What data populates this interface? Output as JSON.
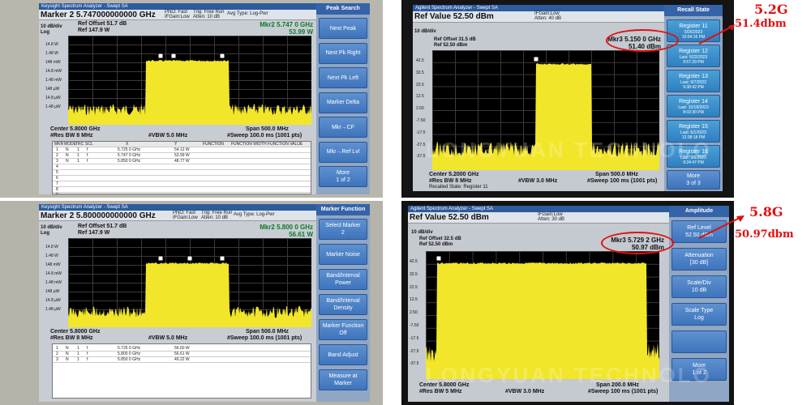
{
  "watermark": "LONGYUAN TECHNOLO",
  "p1": {
    "titlebar": "Keysight Spectrum Analyzer - Swept SA",
    "marker_label": "Marker 2  5.747000000000 GHz",
    "pno": "PNO: Fast",
    "ifgain": "IFGain:Low",
    "trig": "Trig: Free Run",
    "atten": "Atten: 10 dB",
    "avg": "Avg Type: Log-Pwr",
    "scale": "10 dB/div",
    "log": "Log",
    "ref_offset": "Ref Offset 51.7 dB",
    "ref": "Ref 147.9 W",
    "mkr_freq": "Mkr2  5.747 0 GHz",
    "mkr_val": "53.99 W",
    "yticks": [
      "14.8 W",
      "1.48 W",
      "148 mW",
      "14.8 mW",
      "1.48 mW",
      "148 µW",
      "14.8 µW",
      "1.48 µW"
    ],
    "center": "Center 5.8000 GHz",
    "res_bw": "#Res BW 8 MHz",
    "vbw": "#VBW 5.0 MHz",
    "span": "Span 500.0 MHz",
    "sweep": "#Sweep  100.0 ms (1001 pts)",
    "table_header": [
      "MKR",
      "MODE",
      "TRC",
      "SCL",
      "X",
      "Y",
      "FUNCTION",
      "FUNCTION WIDTH",
      "FUNCTION VALUE"
    ],
    "table_rows": [
      {
        "n": "1",
        "mode": "N",
        "trc": "1",
        "scl": "f",
        "x": "5.725 0 GHz",
        "y": "54.12 W"
      },
      {
        "n": "2",
        "mode": "N",
        "trc": "1",
        "scl": "f",
        "x": "5.747 0 GHz",
        "y": "53.99 W"
      },
      {
        "n": "3",
        "mode": "N",
        "trc": "1",
        "scl": "f",
        "x": "5.850 0 GHz",
        "y": "48.77 W"
      }
    ],
    "row_numbers": [
      "4",
      "5",
      "6",
      "7",
      "8",
      "9",
      "10",
      "11"
    ],
    "keys_title": "Peak Search",
    "keys": [
      "Next Peak",
      "Next Pk Right",
      "Next Pk Left",
      "Marker Delta",
      "Mkr→CF",
      "Mkr→Ref Lvl",
      "More\n1 of 2"
    ]
  },
  "p2": {
    "titlebar": "Keysight Spectrum Analyzer - Swept SA",
    "marker_label": "Marker 2  5.800000000000 GHz",
    "pno": "PNO: Fast",
    "ifgain": "IFGain:Low",
    "trig": "Trig: Free Run",
    "atten": "Atten: 10 dB",
    "avg": "Avg Type: Log-Pwr",
    "scale": "10 dB/div",
    "log": "Log",
    "ref_offset": "Ref Offset 51.7 dB",
    "ref": "Ref 147.9 W",
    "mkr_freq": "Mkr2  5.800 0 GHz",
    "mkr_val": "56.61 W",
    "yticks": [
      "14.8 W",
      "1.48 W",
      "148 mW",
      "14.8 mW",
      "1.48 mW",
      "148 µW",
      "14.8 µW",
      "1.48 µW"
    ],
    "center": "Center 5.8000 GHz",
    "res_bw": "#Res BW 8 MHz",
    "vbw": "#VBW 5.0 MHz",
    "span": "Span 500.0 MHz",
    "sweep": "#Sweep  100.0 ms (1001 pts)",
    "table_rows": [
      {
        "n": "1",
        "mode": "N",
        "trc": "1",
        "scl": "f",
        "x": "5.725 0 GHz",
        "y": "56.60 W"
      },
      {
        "n": "2",
        "mode": "N",
        "trc": "1",
        "scl": "f",
        "x": "5.800 0 GHz",
        "y": "56.61 W"
      },
      {
        "n": "3",
        "mode": "N",
        "trc": "1",
        "scl": "f",
        "x": "5.850 0 GHz",
        "y": "49.22 W"
      }
    ],
    "keys_title": "Marker Function",
    "keys": [
      "Select Marker\n2",
      "Marker Noise",
      "Band/Interval Power",
      "Band/Interval Density",
      "Marker Function Off",
      "Band Adjust",
      "Measure at Marker"
    ]
  },
  "p3": {
    "titlebar": "Agilent Spectrum Analyzer - Swept SA",
    "ref_value": "Ref Value 52.50 dBm",
    "ifgain": "IFGain:Low",
    "atten": "Atten: 40 dB",
    "scale": "10 dB/div",
    "ref_offset": "Ref Offset 31.5 dB",
    "ref": "Ref 52.50 dBm",
    "mkr_freq": "Mkr3  5.150 0 GHz",
    "mkr_val": "51.40 dBm",
    "yticks": [
      "42.5",
      "32.5",
      "22.5",
      "12.5",
      "2.50",
      "-7.50",
      "-17.5",
      "-27.5",
      "-37.5"
    ],
    "center": "Center 5.2000 GHz",
    "res_bw": "#Res BW 8 MHz",
    "vbw": "#VBW 3.0 MHz",
    "span": "Span 500.0 MHz",
    "sweep": "#Sweep  100 ms (1001 pts)",
    "status": "Recalled State: Register 11",
    "keys_title": "Recall State",
    "registers": [
      {
        "name": "Register 11",
        "date": "5/26/2023",
        "time": "10:04:16 PM"
      },
      {
        "name": "Register 12",
        "date": "Last: 5/22/2023",
        "time": "9:57:29 PM"
      },
      {
        "name": "Register 13",
        "date": "Last: 9/7/2023",
        "time": "9:38:42 PM"
      },
      {
        "name": "Register 14",
        "date": "Last: 10/18/2023",
        "time": "8:03:30 PM"
      },
      {
        "name": "Register 15",
        "date": "Last: 6/1/2023",
        "time": "12:38:18 PM"
      },
      {
        "name": "Register 16",
        "date": "Last: 9/6/2023",
        "time": "9:24:47 PM"
      }
    ],
    "more": "More\n3 of 3",
    "annotation_line1": "5.2G",
    "annotation_line2": "51.4dbm"
  },
  "p4": {
    "titlebar": "Agilent Spectrum Analyzer - Swept SA",
    "ref_value": "Ref Value 52.50 dBm",
    "ifgain": "IFGain:Low",
    "atten": "Atten: 30 dB",
    "scale": "10 dB/div",
    "ref_offset": "Ref Offset 32.5 dB",
    "ref": "Ref 52.50 dBm",
    "mkr_freq": "Mkr3  5.729 2 GHz",
    "mkr_val": "50.97 dBm",
    "yticks": [
      "42.5",
      "32.5",
      "22.5",
      "12.5",
      "2.50",
      "-7.50",
      "-17.5",
      "-27.5",
      "-37.5"
    ],
    "center": "Center 5.8000 GHz",
    "res_bw": "#Res BW 5 MHz",
    "vbw": "#VBW 3.0 MHz",
    "span": "Span 200.0 MHz",
    "sweep": "#Sweep  100 ms (1001 pts)",
    "keys_title": "Amplitude",
    "keys": [
      "Ref Level\n52.50 dBm",
      "Attenuation\n[30 dB]",
      "Scale/Div\n10 dB",
      "Scale Type\nLog",
      "",
      "More\n1 of 2"
    ],
    "annotation_line1": "5.8G",
    "annotation_line2": "50.97dbm"
  }
}
